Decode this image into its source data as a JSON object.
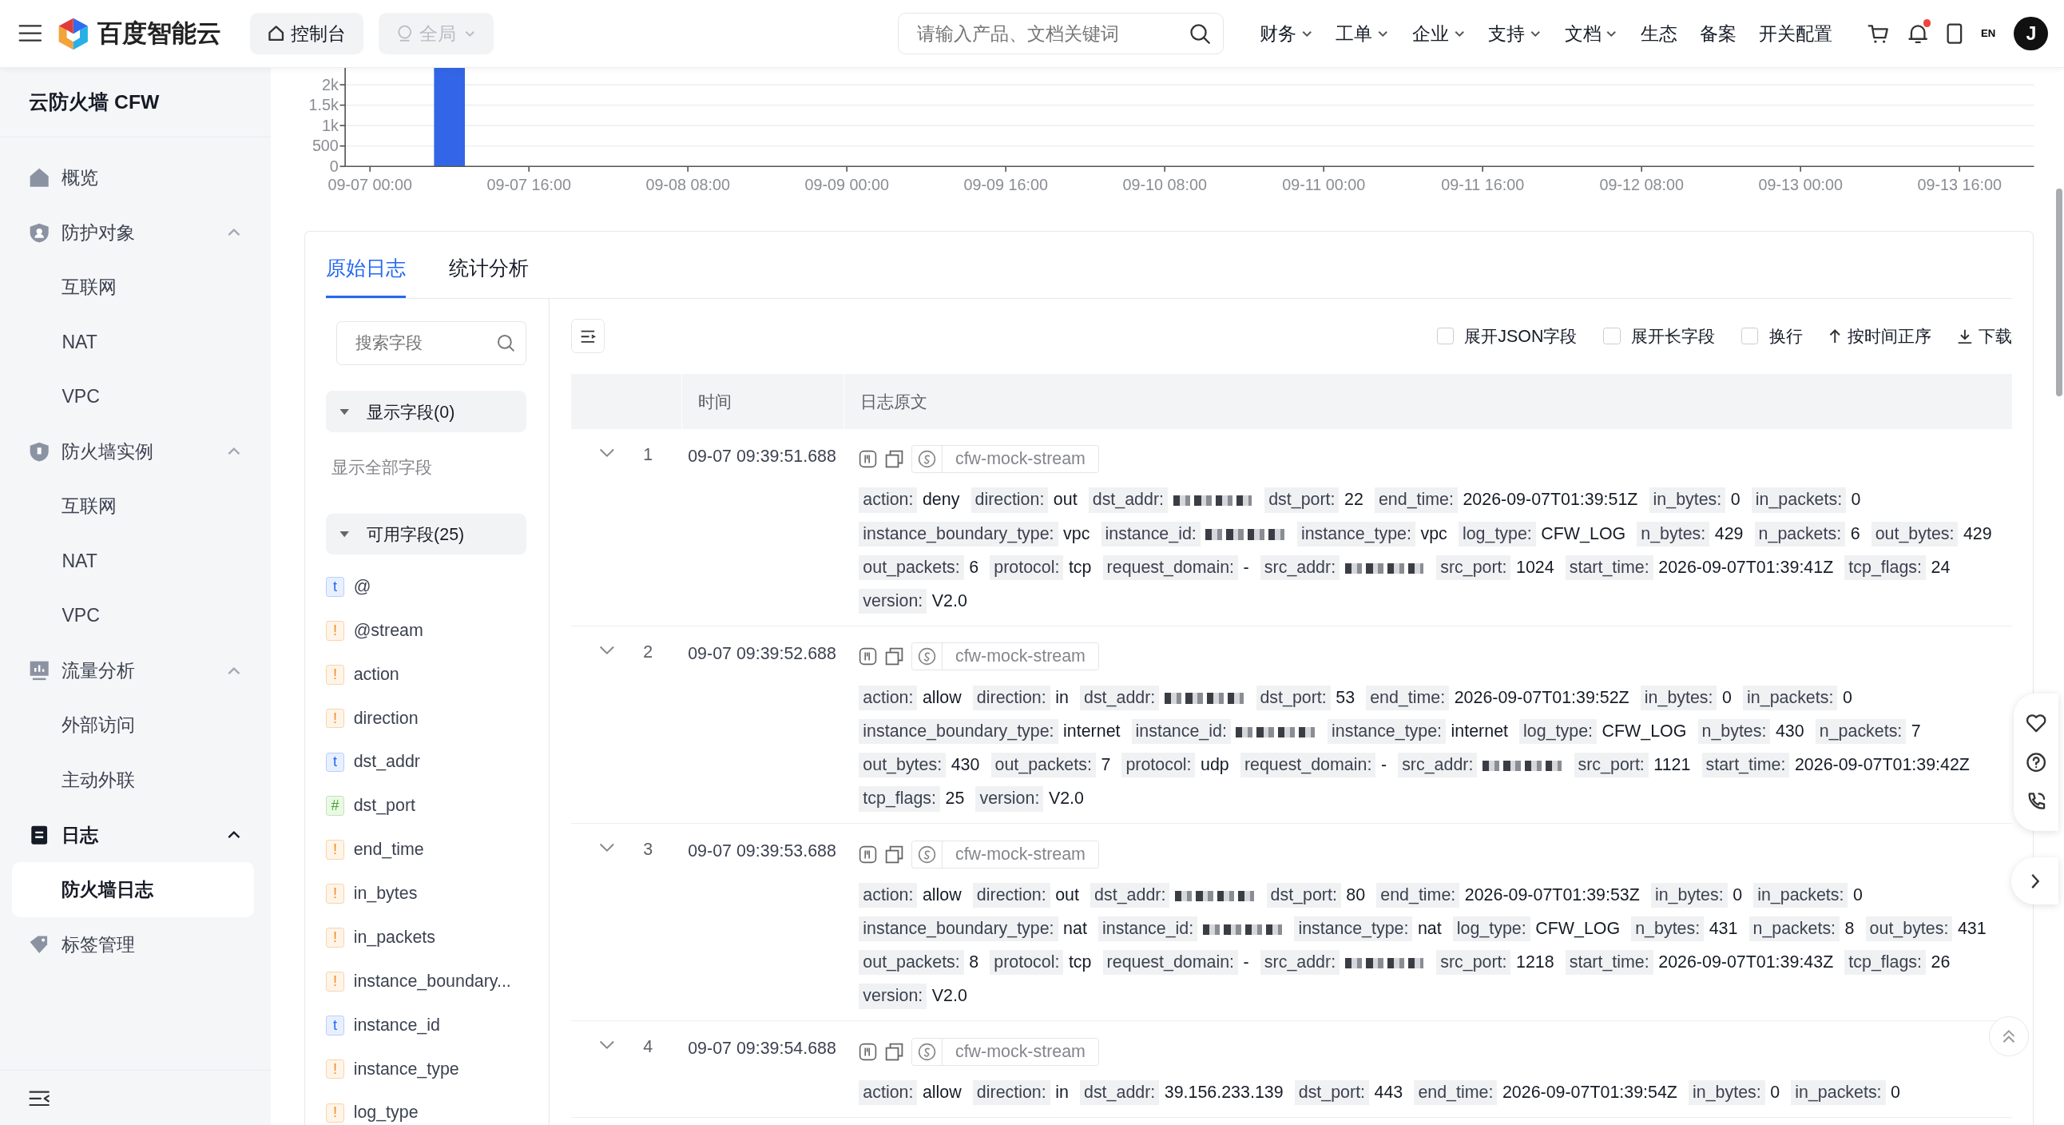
{
  "header": {
    "brand": "百度智能云",
    "console": "控制台",
    "region": {
      "label": "全局",
      "disabled": true
    },
    "search": {
      "placeholder": "请输入产品、文档关键词"
    },
    "nav": [
      {
        "label": "财务",
        "dropdown": true
      },
      {
        "label": "工单",
        "dropdown": true
      },
      {
        "label": "企业",
        "dropdown": true
      },
      {
        "label": "支持",
        "dropdown": true
      },
      {
        "label": "文档",
        "dropdown": true
      },
      {
        "label": "生态",
        "dropdown": false
      },
      {
        "label": "备案",
        "dropdown": false
      },
      {
        "label": "开关配置",
        "dropdown": false
      }
    ],
    "notifications_unread": true,
    "language": "EN",
    "avatar": "J"
  },
  "sidebar": {
    "title": "云防火墙 CFW",
    "items": [
      {
        "label": "概览",
        "active": false
      },
      {
        "label": "防护对象",
        "expanded": true,
        "active": false,
        "children": [
          {
            "label": "互联网",
            "selected": false
          },
          {
            "label": "NAT",
            "selected": false
          },
          {
            "label": "VPC",
            "selected": false
          }
        ]
      },
      {
        "label": "防火墙实例",
        "expanded": true,
        "active": false,
        "children": [
          {
            "label": "互联网",
            "selected": false
          },
          {
            "label": "NAT",
            "selected": false
          },
          {
            "label": "VPC",
            "selected": false
          }
        ]
      },
      {
        "label": "流量分析",
        "expanded": true,
        "active": false,
        "children": [
          {
            "label": "外部访问",
            "selected": false
          },
          {
            "label": "主动外联",
            "selected": false
          }
        ]
      },
      {
        "label": "日志",
        "expanded": true,
        "active": true,
        "children": [
          {
            "label": "防火墙日志",
            "selected": true
          }
        ]
      },
      {
        "label": "标签管理",
        "active": false
      }
    ]
  },
  "histogram": {
    "chart_data": {
      "type": "bar",
      "grid": true,
      "categories": [
        null,
        null,
        "09-07 00:00",
        null,
        null,
        null,
        null,
        null,
        null,
        null,
        null,
        null,
        null,
        null,
        null,
        null,
        null,
        null,
        "09-07 16:00",
        null,
        null,
        null,
        null,
        null,
        null,
        null,
        null,
        null,
        null,
        null,
        null,
        null,
        null,
        null,
        "09-08 08:00",
        null,
        null,
        null,
        null,
        null,
        null,
        null,
        null,
        null,
        null,
        null,
        null,
        null,
        null,
        null,
        "09-09 00:00",
        null,
        null,
        null,
        null,
        null,
        null,
        null,
        null,
        null,
        null,
        null,
        null,
        null,
        null,
        null,
        "09-09 16:00",
        null,
        null,
        null,
        null,
        null,
        null,
        null,
        null,
        null,
        null,
        null,
        null,
        null,
        null,
        null,
        "09-10 08:00",
        null,
        null,
        null,
        null,
        null,
        null,
        null,
        null,
        null,
        null,
        null,
        null,
        null,
        null,
        null,
        "09-11 00:00",
        null,
        null,
        null,
        null,
        null,
        null,
        null,
        null,
        null,
        null,
        null,
        null,
        null,
        null,
        null,
        "09-11 16:00",
        null,
        null,
        null,
        null,
        null,
        null,
        null,
        null,
        null,
        null,
        null,
        null,
        null,
        null,
        null,
        "09-12 08:00",
        null,
        null,
        null,
        null,
        null,
        null,
        null,
        null,
        null,
        null,
        null,
        null,
        null,
        null,
        null,
        "09-13 00:00",
        null,
        null,
        null,
        null,
        null,
        null,
        null,
        null,
        null,
        null,
        null,
        null,
        null,
        null,
        null,
        "09-13 16:00",
        null,
        null,
        null,
        null,
        null,
        null,
        null
      ],
      "series": [
        {
          "color": "#3366e6",
          "values": [
            0,
            0,
            0,
            0,
            0,
            0,
            0,
            0,
            0,
            2450,
            2450,
            2450,
            0,
            0,
            0,
            0,
            0,
            0,
            0,
            0,
            0,
            0,
            0,
            0,
            0,
            0,
            0,
            0,
            0,
            0,
            0,
            0,
            0,
            0,
            0,
            0,
            0,
            0,
            0,
            0,
            0,
            0,
            0,
            0,
            0,
            0,
            0,
            0,
            0,
            0,
            0,
            0,
            0,
            0,
            0,
            0,
            0,
            0,
            0,
            0,
            0,
            0,
            0,
            0,
            0,
            0,
            0,
            0,
            0,
            0,
            0,
            0,
            0,
            0,
            0,
            0,
            0,
            0,
            0,
            0,
            0,
            0,
            0,
            0,
            0,
            0,
            0,
            0,
            0,
            0,
            0,
            0,
            0,
            0,
            0,
            0,
            0,
            0,
            0,
            0,
            0,
            0,
            0,
            0,
            0,
            0,
            0,
            0,
            0,
            0,
            0,
            0,
            0,
            0,
            0,
            0,
            0,
            0,
            0,
            0,
            0,
            0,
            0,
            0,
            0,
            0,
            0,
            0,
            0,
            0,
            0,
            0,
            0,
            0,
            0,
            0,
            0,
            0,
            0,
            0,
            0,
            0,
            0,
            0,
            0,
            0,
            0,
            0,
            0,
            0,
            0,
            0,
            0,
            0,
            0,
            0,
            0,
            0,
            0,
            0,
            0,
            0,
            0,
            0,
            0,
            0,
            0,
            0,
            0,
            0
          ]
        }
      ],
      "ylim": [
        0,
        2500
      ],
      "yticks": [
        {
          "value": 0,
          "label": "0"
        },
        {
          "value": 500,
          "label": "500"
        },
        {
          "value": 1000,
          "label": "1k"
        },
        {
          "value": 1500,
          "label": "1.5k"
        },
        {
          "value": 2000,
          "label": "2k"
        }
      ]
    }
  },
  "tabs": [
    {
      "label": "原始日志",
      "selected": true
    },
    {
      "label": "统计分析",
      "selected": false
    }
  ],
  "fields_panel": {
    "search": {
      "placeholder": "搜索字段"
    },
    "shown_group": {
      "label": "显示字段(0)",
      "expanded": true
    },
    "show_all": "显示全部字段",
    "available_group": {
      "label": "可用字段(25)",
      "expanded": true
    },
    "fields": [
      {
        "kind": "text",
        "badge": "t",
        "name": "@"
      },
      {
        "kind": "string",
        "badge": "!",
        "name": "@stream"
      },
      {
        "kind": "string",
        "badge": "!",
        "name": "action"
      },
      {
        "kind": "string",
        "badge": "!",
        "name": "direction"
      },
      {
        "kind": "text",
        "badge": "t",
        "name": "dst_addr"
      },
      {
        "kind": "number",
        "badge": "#",
        "name": "dst_port"
      },
      {
        "kind": "string",
        "badge": "!",
        "name": "end_time"
      },
      {
        "kind": "string",
        "badge": "!",
        "name": "in_bytes"
      },
      {
        "kind": "string",
        "badge": "!",
        "name": "in_packets"
      },
      {
        "kind": "string",
        "badge": "!",
        "name": "instance_boundary..."
      },
      {
        "kind": "text",
        "badge": "t",
        "name": "instance_id"
      },
      {
        "kind": "string",
        "badge": "!",
        "name": "instance_type"
      },
      {
        "kind": "string",
        "badge": "!",
        "name": "log_type"
      }
    ]
  },
  "toolbar": {
    "options": [
      {
        "label": "展开JSON字段",
        "checked": false
      },
      {
        "label": "展开长字段",
        "checked": false
      },
      {
        "label": "换行",
        "checked": false
      }
    ],
    "sort": "按时间正序",
    "download": "下载"
  },
  "table": {
    "columns": [
      "时间",
      "日志原文"
    ],
    "rows": [
      {
        "index": "1",
        "time": "09-07 09:39:51.688",
        "expanded": false,
        "stream": "cfw-mock-stream",
        "fields": [
          {
            "key": "action:",
            "value": "deny"
          },
          {
            "key": "direction:",
            "value": "out"
          },
          {
            "key": "dst_addr:",
            "masked": true
          },
          {
            "key": "dst_port:",
            "value": "22"
          },
          {
            "key": "end_time:",
            "value": "2026-09-07T01:39:51Z"
          },
          {
            "key": "in_bytes:",
            "value": "0"
          },
          {
            "key": "in_packets:",
            "value": "0"
          },
          {
            "key": "instance_boundary_type:",
            "value": "vpc"
          },
          {
            "key": "instance_id:",
            "masked": true
          },
          {
            "key": "instance_type:",
            "value": "vpc"
          },
          {
            "key": "log_type:",
            "value": "CFW_LOG"
          },
          {
            "key": "n_bytes:",
            "value": "429"
          },
          {
            "key": "n_packets:",
            "value": "6"
          },
          {
            "key": "out_bytes:",
            "value": "429"
          },
          {
            "key": "out_packets:",
            "value": "6"
          },
          {
            "key": "protocol:",
            "value": "tcp"
          },
          {
            "key": "request_domain:",
            "value": "-"
          },
          {
            "key": "src_addr:",
            "masked": true
          },
          {
            "key": "src_port:",
            "value": "1024"
          },
          {
            "key": "start_time:",
            "value": "2026-09-07T01:39:41Z"
          },
          {
            "key": "tcp_flags:",
            "value": "24"
          },
          {
            "key": "version:",
            "value": "V2.0"
          }
        ]
      },
      {
        "index": "2",
        "time": "09-07 09:39:52.688",
        "expanded": false,
        "stream": "cfw-mock-stream",
        "fields": [
          {
            "key": "action:",
            "value": "allow"
          },
          {
            "key": "direction:",
            "value": "in"
          },
          {
            "key": "dst_addr:",
            "masked": true
          },
          {
            "key": "dst_port:",
            "value": "53"
          },
          {
            "key": "end_time:",
            "value": "2026-09-07T01:39:52Z"
          },
          {
            "key": "in_bytes:",
            "value": "0"
          },
          {
            "key": "in_packets:",
            "value": "0"
          },
          {
            "key": "instance_boundary_type:",
            "value": "internet"
          },
          {
            "key": "instance_id:",
            "masked": true
          },
          {
            "key": "instance_type:",
            "value": "internet"
          },
          {
            "key": "log_type:",
            "value": "CFW_LOG"
          },
          {
            "key": "n_bytes:",
            "value": "430"
          },
          {
            "key": "n_packets:",
            "value": "7"
          },
          {
            "key": "out_bytes:",
            "value": "430"
          },
          {
            "key": "out_packets:",
            "value": "7"
          },
          {
            "key": "protocol:",
            "value": "udp"
          },
          {
            "key": "request_domain:",
            "value": "-"
          },
          {
            "key": "src_addr:",
            "masked": true
          },
          {
            "key": "src_port:",
            "value": "1121"
          },
          {
            "key": "start_time:",
            "value": "2026-09-07T01:39:42Z"
          },
          {
            "key": "tcp_flags:",
            "value": "25"
          },
          {
            "key": "version:",
            "value": "V2.0"
          }
        ]
      },
      {
        "index": "3",
        "time": "09-07 09:39:53.688",
        "expanded": false,
        "stream": "cfw-mock-stream",
        "fields": [
          {
            "key": "action:",
            "value": "allow"
          },
          {
            "key": "direction:",
            "value": "out"
          },
          {
            "key": "dst_addr:",
            "masked": true
          },
          {
            "key": "dst_port:",
            "value": "80"
          },
          {
            "key": "end_time:",
            "value": "2026-09-07T01:39:53Z"
          },
          {
            "key": "in_bytes:",
            "value": "0"
          },
          {
            "key": "in_packets:",
            "value": "0"
          },
          {
            "key": "instance_boundary_type:",
            "value": "nat"
          },
          {
            "key": "instance_id:",
            "masked": true
          },
          {
            "key": "instance_type:",
            "value": "nat"
          },
          {
            "key": "log_type:",
            "value": "CFW_LOG"
          },
          {
            "key": "n_bytes:",
            "value": "431"
          },
          {
            "key": "n_packets:",
            "value": "8"
          },
          {
            "key": "out_bytes:",
            "value": "431"
          },
          {
            "key": "out_packets:",
            "value": "8"
          },
          {
            "key": "protocol:",
            "value": "tcp"
          },
          {
            "key": "request_domain:",
            "value": "-"
          },
          {
            "key": "src_addr:",
            "masked": true
          },
          {
            "key": "src_port:",
            "value": "1218"
          },
          {
            "key": "start_time:",
            "value": "2026-09-07T01:39:43Z"
          },
          {
            "key": "tcp_flags:",
            "value": "26"
          },
          {
            "key": "version:",
            "value": "V2.0"
          }
        ]
      },
      {
        "index": "4",
        "time": "09-07 09:39:54.688",
        "expanded": false,
        "stream": "cfw-mock-stream",
        "fields": [
          {
            "key": "action:",
            "value": "allow"
          },
          {
            "key": "direction:",
            "value": "in"
          },
          {
            "key": "dst_addr:",
            "value": "39.156.233.139"
          },
          {
            "key": "dst_port:",
            "value": "443"
          },
          {
            "key": "end_time:",
            "value": "2026-09-07T01:39:54Z"
          },
          {
            "key": "in_bytes:",
            "value": "0"
          },
          {
            "key": "in_packets:",
            "value": "0"
          }
        ]
      }
    ]
  }
}
